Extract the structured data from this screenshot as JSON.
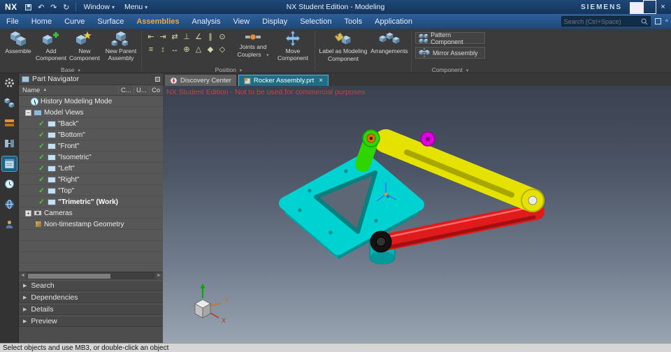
{
  "ui": {
    "caret_down": "▾",
    "check": "✓",
    "plus": "+",
    "minus": "−",
    "arrow_right": "▶",
    "sort_asc": "▲",
    "close_x": "×",
    "undo": "↶",
    "redo": "↷",
    "refresh": "↻",
    "scroll_left": "◄",
    "scroll_right": "►",
    "chevron_up": "^"
  },
  "titlebar": {
    "logo": "NX",
    "window_menu": "Window",
    "menu_menu": "Menu",
    "title": "NX Student Edition - Modeling",
    "brand": "SIEMENS"
  },
  "menubar": {
    "tabs": [
      "File",
      "Home",
      "Curve",
      "Surface",
      "Assemblies",
      "Analysis",
      "View",
      "Display",
      "Selection",
      "Tools",
      "Application"
    ],
    "active_tab": "Assemblies",
    "search_placeholder": "Search (Ctrl+Space)"
  },
  "ribbon": {
    "assemble": "Assemble",
    "add_component": "Add Component",
    "new_component": "New Component",
    "new_parent_assembly": "New Parent Assembly",
    "base_group": "Base",
    "joints_couplers_1": "Joints and",
    "joints_couplers_2": "Couplers",
    "move_component": "Move Component",
    "position_group": "Position",
    "label_modeling_1": "Label as Modeling",
    "label_modeling_2": "Component",
    "arrangements": "Arrangements",
    "pattern_component": "Pattern Component",
    "mirror_assembly": "Mirror Assembly",
    "component_group": "Component",
    "position_icons_row1": [
      "⇤",
      "⇥",
      "⇄",
      "⊥",
      "∠",
      "∥",
      "⊙"
    ],
    "position_icons_row2": [
      "≡",
      "↕",
      "↔",
      "⊕",
      "△",
      "◆",
      "◇"
    ]
  },
  "doc_tabs": {
    "discovery": "Discovery Center",
    "part": "Rocker Assembly.prt"
  },
  "navigator": {
    "title": "Part Navigator",
    "columns": {
      "name": "Name",
      "c": "C...",
      "u": "U...",
      "co": "Co"
    },
    "rows": [
      "History Modeling Mode",
      "Model Views",
      "\"Back\"",
      "\"Bottom\"",
      "\"Front\"",
      "\"Isometric\"",
      "\"Left\"",
      "\"Right\"",
      "\"Top\"",
      "\"Trimetric\" (Work)",
      "Cameras",
      "Non-timestamp Geometry"
    ],
    "sections": [
      "Search",
      "Dependencies",
      "Details",
      "Preview"
    ]
  },
  "viewport": {
    "watermark": "NX Student Edition - Not to be used for commercial purposes",
    "triad": {
      "x": "X",
      "y": "Y"
    }
  },
  "statusbar": {
    "message": "Select objects and use MB3, or double-click an object"
  },
  "colors": {
    "titlebar_blue": "#1e4878",
    "accent_orange": "#f2a63e",
    "tab_active_cyan": "#3fc1dc",
    "watermark_red": "#d04040",
    "model_cyan": "#00d2d2",
    "model_cyan_dark": "#009e9e",
    "model_green": "#2fd500",
    "model_yellow": "#e6e200",
    "model_red": "#e01b1b",
    "model_magenta": "#de00de",
    "model_orange": "#e07800"
  }
}
